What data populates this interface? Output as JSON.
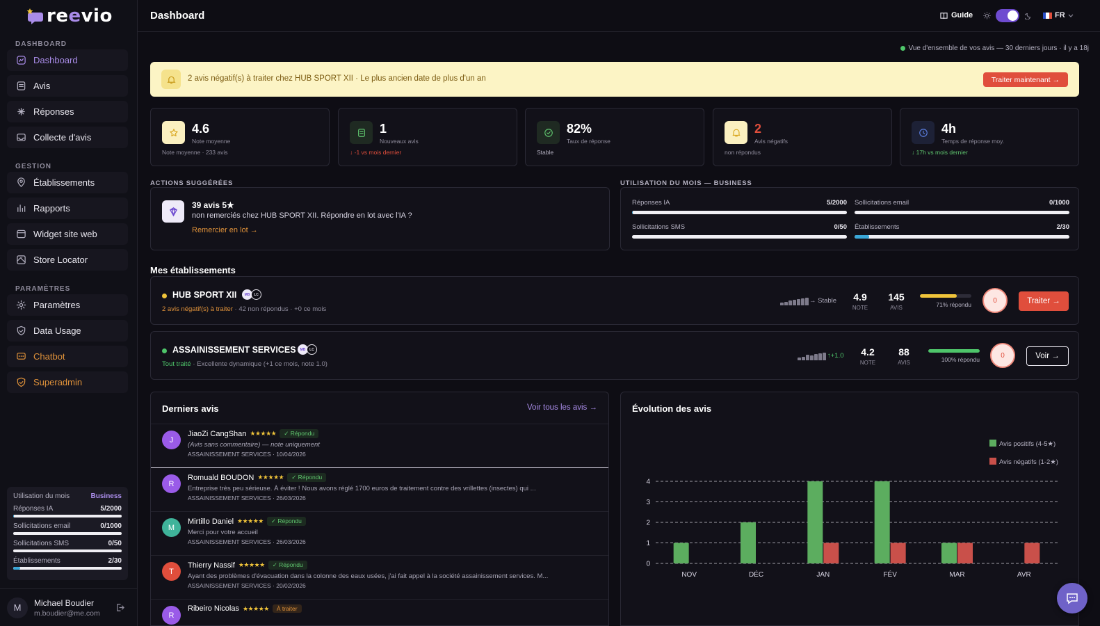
{
  "app": {
    "name": "reevio",
    "page_title": "Dashboard"
  },
  "topbar": {
    "guide": "Guide",
    "lang": "FR"
  },
  "sidebar": {
    "sections": [
      {
        "title": "DASHBOARD",
        "items": [
          {
            "label": "Dashboard",
            "icon": "dashboard-icon",
            "active": true
          },
          {
            "label": "Avis",
            "icon": "reviews-icon"
          },
          {
            "label": "Réponses",
            "icon": "replies-icon"
          },
          {
            "label": "Collecte d'avis",
            "icon": "inbox-icon"
          }
        ]
      },
      {
        "title": "GESTION",
        "items": [
          {
            "label": "Établissements",
            "icon": "location-pin-icon"
          },
          {
            "label": "Rapports",
            "icon": "bar-chart-icon"
          },
          {
            "label": "Widget site web",
            "icon": "widget-icon"
          },
          {
            "label": "Store Locator",
            "icon": "map-icon"
          }
        ]
      },
      {
        "title": "PARAMÈTRES",
        "items": [
          {
            "label": "Paramètres",
            "icon": "gear-icon"
          },
          {
            "label": "Data Usage",
            "icon": "shield-icon"
          },
          {
            "label": "Chatbot",
            "icon": "chat-icon",
            "accent": "#e0923a"
          },
          {
            "label": "Superadmin",
            "icon": "shield-check-icon",
            "accent": "#e0923a"
          }
        ]
      }
    ],
    "usage": {
      "title": "Utilisation du mois",
      "plan": "Business",
      "rows": [
        {
          "label": "Réponses IA",
          "value": "5/2000",
          "fraction": 0.0025
        },
        {
          "label": "Sollicitations email",
          "value": "0/1000",
          "fraction": 0
        },
        {
          "label": "Sollicitations SMS",
          "value": "0/50",
          "fraction": 0
        },
        {
          "label": "Établissements",
          "value": "2/30",
          "fraction": 0.067
        }
      ]
    },
    "user": {
      "initial": "M",
      "name": "Michael Boudier",
      "email": "m.boudier@me.com"
    }
  },
  "overview": "Vue d'ensemble de vos avis — 30 derniers jours · il y a 18j",
  "alert": {
    "text": "2 avis négatif(s) à traiter chez HUB SPORT XII · Le plus ancien date de plus d'un an",
    "button": "Traiter maintenant →"
  },
  "kpis": [
    {
      "value": "4.6",
      "label": "Note moyenne",
      "sub": "Note moyenne · 233 avis",
      "icon": "star-icon",
      "bg": "#fbf0c0",
      "color": "#d9a61e",
      "sub_color": "#8f8c9c"
    },
    {
      "value": "1",
      "label": "Nouveaux avis",
      "sub": "↓ -1 vs mois dernier",
      "icon": "document-icon",
      "bg": "#1f2a22",
      "color": "#5fc46e",
      "sub_color": "#e04e3c"
    },
    {
      "value": "82%",
      "label": "Taux de réponse",
      "sub": "Stable",
      "icon": "check-circle-icon",
      "bg": "#1f2a22",
      "color": "#5fc46e",
      "sub_color": "#b5b2c2"
    },
    {
      "value": "2",
      "label": "Avis négatifs",
      "sub": "non répondus",
      "icon": "bell-icon",
      "bg": "#fbf0c0",
      "color": "#d9a61e",
      "sub_color": "#8f8c9c",
      "value_color": "#e04e3c"
    },
    {
      "value": "4h",
      "label": "Temps de réponse moy.",
      "sub": "↓ 17h vs mois dernier",
      "icon": "clock-icon",
      "bg": "#1d2136",
      "color": "#5b7ee0",
      "sub_color": "#5fc46e"
    }
  ],
  "suggested": {
    "heading": "ACTIONS SUGGÉRÉES",
    "title": "39 avis 5★",
    "text": "non remerciés chez HUB SPORT XII. Répondre en lot avec l'IA ?",
    "link": "Remercier en lot →"
  },
  "monthly_usage": {
    "heading": "UTILISATION DU MOIS — BUSINESS",
    "rows": [
      {
        "label": "Réponses IA",
        "value": "5/2000",
        "fraction": 0.0025
      },
      {
        "label": "Sollicitations email",
        "value": "0/1000",
        "fraction": 0
      },
      {
        "label": "Sollicitations SMS",
        "value": "0/50",
        "fraction": 0
      },
      {
        "label": "Établissements",
        "value": "2/30",
        "fraction": 0.067
      }
    ]
  },
  "establishments": {
    "heading": "Mes établissements",
    "items": [
      {
        "name": "HUB SPORT XII",
        "status_color": "#f0c43a",
        "badges": [
          "MB",
          "LC"
        ],
        "sub_highlight": "2 avis négatif(s) à traiter",
        "sub_highlight_color": "#e0923a",
        "sub_rest": " · 42 non répondus · +0 ce mois",
        "spark": [
          0.4,
          0.5,
          0.6,
          0.7,
          0.8,
          0.9,
          1.0
        ],
        "trend": "→ Stable",
        "trend_color": "#a9a6b6",
        "note": "4.9",
        "note_label": "NOTE",
        "count": "145",
        "count_label": "AVIS",
        "response": 0.71,
        "response_label": "71% répondu",
        "response_color": "#f0c43a",
        "ring": "0",
        "action": "Traiter →",
        "action_style": "primary"
      },
      {
        "name": "ASSAINISSEMENT SERVICES",
        "status_color": "#4ec56a",
        "badges": [
          "MB",
          "LC"
        ],
        "sub_highlight": "Tout traité",
        "sub_highlight_color": "#4ec56a",
        "sub_rest": " · Excellente dynamique (+1 ce mois, note 1.0)",
        "spark": [
          0.4,
          0.5,
          0.7,
          0.6,
          0.8,
          0.9,
          1.0
        ],
        "trend": "↑+1.0",
        "trend_color": "#4ec56a",
        "note": "4.2",
        "note_label": "NOTE",
        "count": "88",
        "count_label": "AVIS",
        "response": 1.0,
        "response_label": "100% répondu",
        "response_color": "#4ec56a",
        "ring": "0",
        "action": "Voir →",
        "action_style": "outline"
      }
    ]
  },
  "reviews": {
    "heading": "Derniers avis",
    "see_all": "Voir tous les avis →",
    "items": [
      {
        "initial": "J",
        "color": "#9a5be8",
        "name": "JiaoZi CangShan",
        "stars": "★★★★★",
        "tag": "✓ Répondu",
        "tag_type": "ok",
        "body": "(Avis sans commentaire) — note uniquement",
        "italic": true,
        "place": "ASSAINISSEMENT SERVICES",
        "date": "· 10/04/2026"
      },
      {
        "initial": "R",
        "color": "#9a5be8",
        "name": "Romuald BOUDON",
        "stars": "★★★★★",
        "tag": "✓ Répondu",
        "tag_type": "ok",
        "body": "Entreprise très peu sérieuse. À éviter ! Nous avons réglé 1700 euros de traitement contre des vrillettes (insectes) qui ...",
        "place": "ASSAINISSEMENT SERVICES",
        "date": "· 26/03/2026"
      },
      {
        "initial": "M",
        "color": "#3fb39a",
        "name": "Mirtillo Daniel",
        "stars": "★★★★★",
        "tag": "✓ Répondu",
        "tag_type": "ok",
        "body": "Merci pour votre accueil",
        "place": "ASSAINISSEMENT SERVICES",
        "date": "· 26/03/2026"
      },
      {
        "initial": "T",
        "color": "#e04e3c",
        "name": "Thierry Nassif",
        "stars": "★★★★★",
        "tag": "✓ Répondu",
        "tag_type": "ok",
        "body": "Ayant des problèmes d'évacuation dans la colonne des eaux usées, j'ai fait appel à la société assainissement services. M...",
        "place": "ASSAINISSEMENT SERVICES",
        "date": "· 20/02/2026"
      },
      {
        "initial": "R",
        "color": "#9a5be8",
        "name": "Ribeiro Nicolas",
        "stars": "★★★★★",
        "tag": "À traiter",
        "tag_type": "todo",
        "body": "",
        "place": "",
        "date": ""
      }
    ]
  },
  "chart_data": {
    "type": "bar",
    "title": "Évolution des avis",
    "categories": [
      "NOV",
      "DÉC",
      "JAN",
      "FÉV",
      "MAR",
      "AVR"
    ],
    "series": [
      {
        "name": "Avis positifs (4-5★)",
        "color": "#5cad5f",
        "values": [
          1,
          2,
          4,
          4,
          1,
          0
        ]
      },
      {
        "name": "Avis négatifs (1-2★)",
        "color": "#c9504a",
        "values": [
          0,
          0,
          1,
          1,
          1,
          1
        ]
      }
    ],
    "yticks": [
      0,
      1,
      2,
      3,
      4
    ],
    "ylim": [
      0,
      4
    ],
    "grid": true,
    "legend": "top-right"
  }
}
